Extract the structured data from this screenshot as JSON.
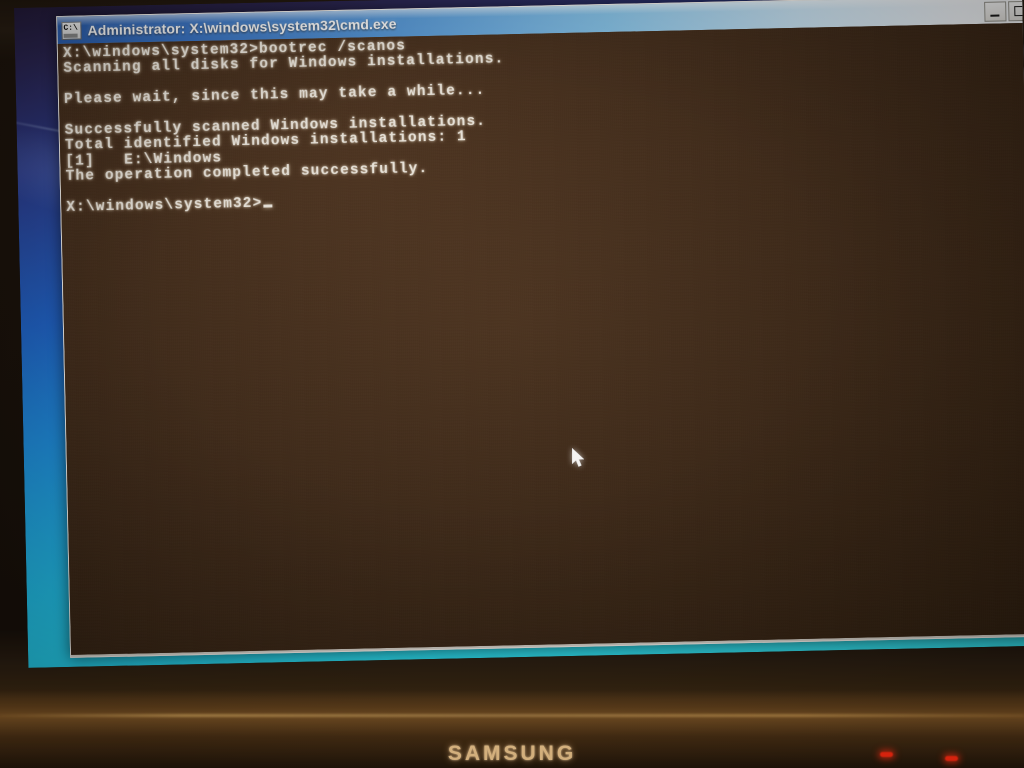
{
  "window": {
    "title": "Administrator: X:\\windows\\system32\\cmd.exe",
    "icon": "cmd-console-icon",
    "controls": {
      "minimize_label": "_",
      "maximize_label": "",
      "close_label": "×"
    }
  },
  "console": {
    "lines": [
      "X:\\windows\\system32>bootrec /scanos",
      "Scanning all disks for Windows installations.",
      "",
      "Please wait, since this may take a while...",
      "",
      "Successfully scanned Windows installations.",
      "Total identified Windows installations: 1",
      "[1]   E:\\Windows",
      "The operation completed successfully.",
      "",
      "X:\\windows\\system32>"
    ],
    "prompt": "X:\\windows\\system32>",
    "command": "bootrec /scanos",
    "cursor": "block-cursor",
    "background_color": "#3d2817",
    "text_color": "#f4efe6"
  },
  "scrollbar": {
    "up_arrow": "scroll-up-arrow",
    "down_arrow": "scroll-down-arrow"
  },
  "monitor": {
    "brand": "SAMSUNG",
    "bezel_color": "#1a1108",
    "led_color": "#ff2a10"
  },
  "desktop": {
    "wallpaper_top_color": "#241b3a",
    "wallpaper_bottom_color": "#39edf9"
  },
  "pointer": {
    "type": "arrow-cursor"
  }
}
